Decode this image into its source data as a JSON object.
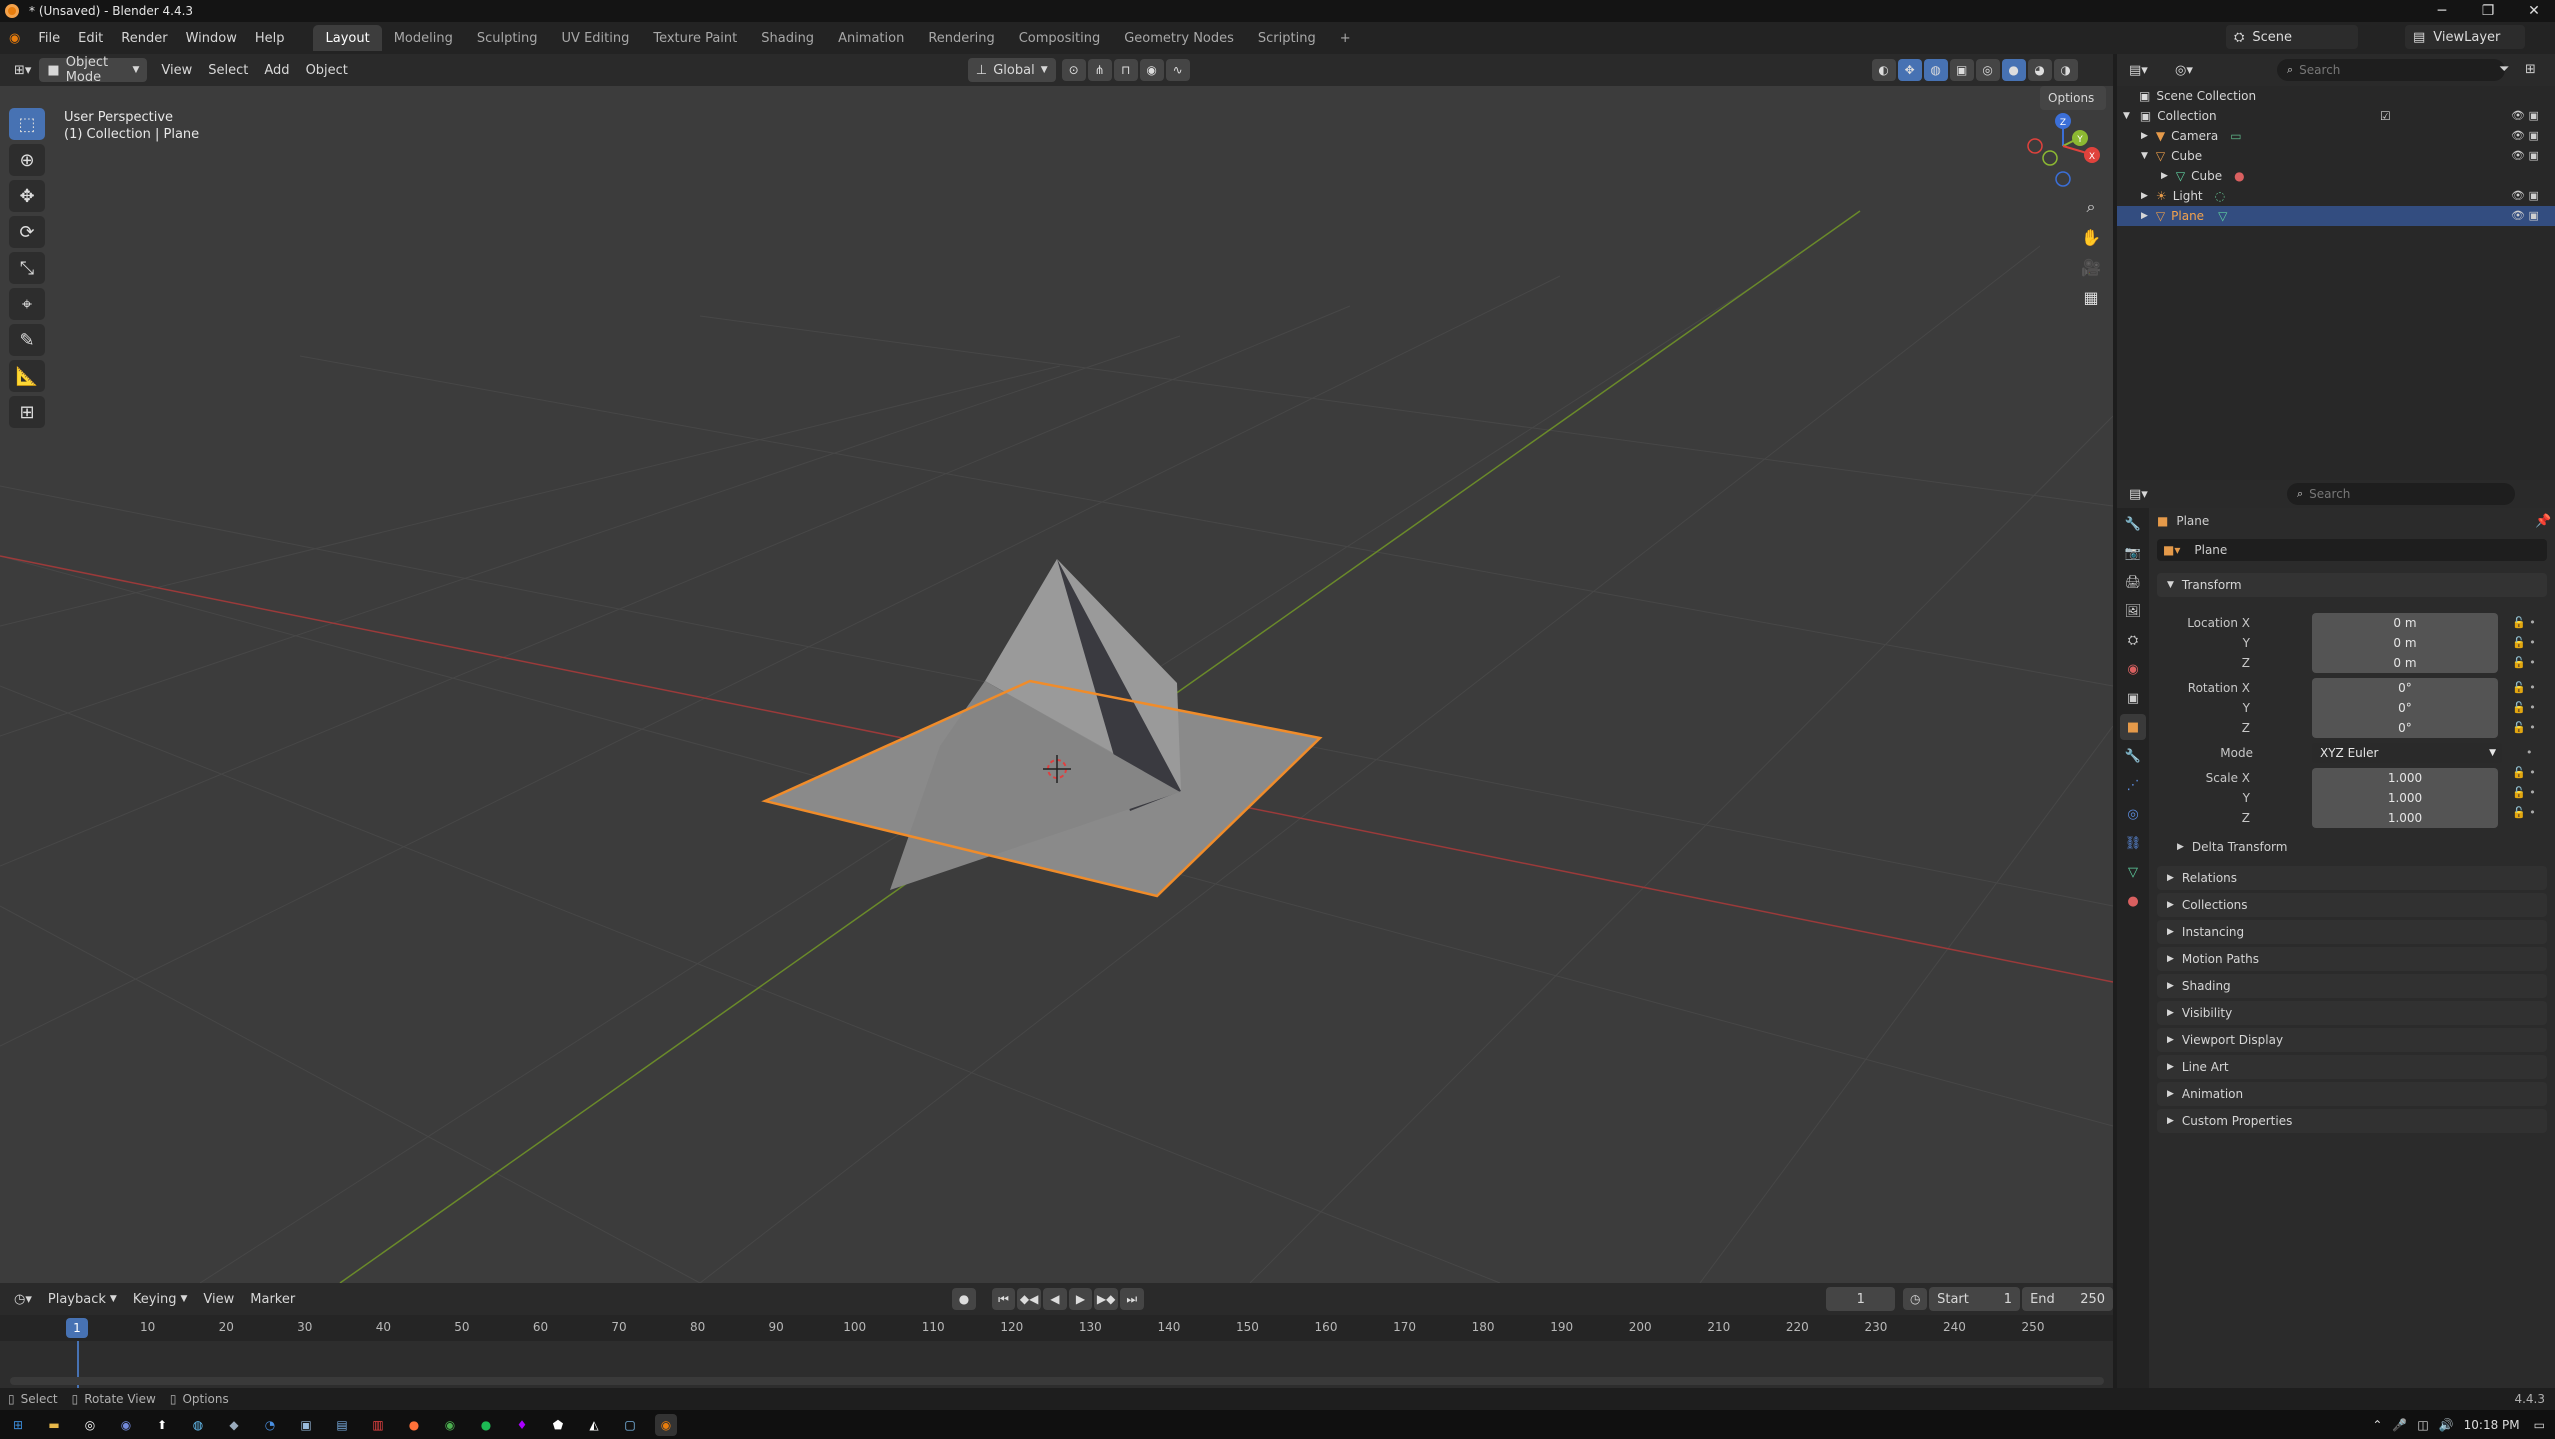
{
  "window": {
    "title": "* (Unsaved) - Blender 4.4.3"
  },
  "menu": [
    "File",
    "Edit",
    "Render",
    "Window",
    "Help"
  ],
  "workspaces": [
    "Layout",
    "Modeling",
    "Sculpting",
    "UV Editing",
    "Texture Paint",
    "Shading",
    "Animation",
    "Rendering",
    "Compositing",
    "Geometry Nodes",
    "Scripting"
  ],
  "active_workspace": "Layout",
  "scene": {
    "scene_name": "Scene",
    "view_layer": "ViewLayer"
  },
  "viewport_header": {
    "mode": "Object Mode",
    "menus": [
      "View",
      "Select",
      "Add",
      "Object"
    ],
    "orientation": "Global",
    "options_label": "Options"
  },
  "viewport": {
    "perspective": "User Perspective",
    "context": "(1) Collection | Plane"
  },
  "outliner": {
    "search_placeholder": "Search",
    "rows": [
      {
        "name": "Scene Collection"
      },
      {
        "name": "Collection"
      },
      {
        "name": "Camera"
      },
      {
        "name": "Cube"
      },
      {
        "name": "Cube"
      },
      {
        "name": "Light"
      },
      {
        "name": "Plane"
      }
    ]
  },
  "properties": {
    "search_placeholder": "Search",
    "object_name": "Plane",
    "datablock_name": "Plane",
    "transform_label": "Transform",
    "location_label": "Location X",
    "rotation_label": "Rotation X",
    "scale_label": "Scale X",
    "y_label": "Y",
    "z_label": "Z",
    "mode_label": "Mode",
    "location": [
      "0 m",
      "0 m",
      "0 m"
    ],
    "rotation": [
      "0°",
      "0°",
      "0°"
    ],
    "mode": "XYZ Euler",
    "scale": [
      "1.000",
      "1.000",
      "1.000"
    ],
    "delta_transform": "Delta Transform",
    "panels": [
      "Relations",
      "Collections",
      "Instancing",
      "Motion Paths",
      "Shading",
      "Visibility",
      "Viewport Display",
      "Line Art",
      "Animation",
      "Custom Properties"
    ]
  },
  "timeline": {
    "menus": [
      "Playback",
      "Keying",
      "View",
      "Marker"
    ],
    "current_frame": "1",
    "start_label": "Start",
    "start": "1",
    "end_label": "End",
    "end": "250",
    "ticks": [
      "1",
      "10",
      "20",
      "30",
      "40",
      "50",
      "60",
      "70",
      "80",
      "90",
      "100",
      "110",
      "120",
      "130",
      "140",
      "150",
      "160",
      "170",
      "180",
      "190",
      "200",
      "210",
      "220",
      "230",
      "240",
      "250"
    ]
  },
  "status": {
    "select": "Select",
    "rotate": "Rotate View",
    "options": "Options",
    "version": "4.4.3"
  },
  "taskbar": {
    "time": "10:18 PM"
  }
}
